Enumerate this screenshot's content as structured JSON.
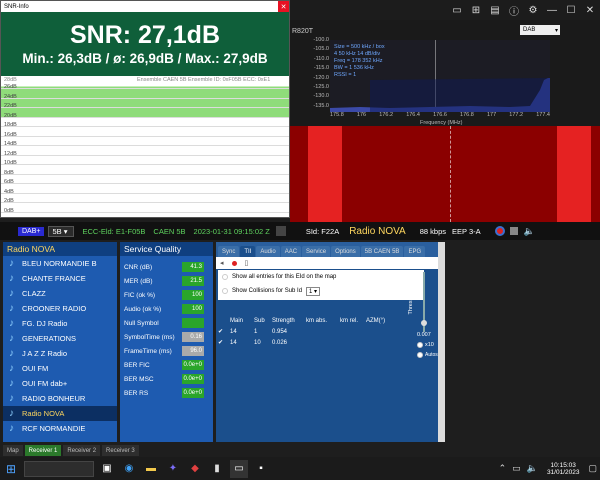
{
  "snr": {
    "window_title": "SNR-Info",
    "main": "SNR: 27,1dB",
    "stats": "Min.: 26,3dB / ø: 26,9dB / Max.: 27,9dB",
    "chart_header": "Ensemble CAEN 5B  Ensemble ID: 0xF05B  ECC: 0xE1",
    "y_top": "28dB",
    "y_labels": [
      "26dB",
      "24dB",
      "22dB",
      "20dB",
      "18dB",
      "16dB",
      "14dB",
      "12dB",
      "10dB",
      "8dB",
      "6dB",
      "4dB",
      "2dB",
      "0dB"
    ],
    "fill_color": "#8fdc7a"
  },
  "spectrum": {
    "device": "R820T",
    "mode": "DAB",
    "info_lines": [
      "Size = 500 kHz / box",
      "4 50 kHz 14 dB/div",
      "Freq = 178 352 kHz",
      "BW = 1 536 kHz",
      "RSSI = 1"
    ],
    "y_ticks": [
      "-100.0",
      "-105.0",
      "-110.0",
      "-115.0",
      "-120.0",
      "-125.0",
      "-130.0",
      "-135.0"
    ],
    "x_ticks": [
      "175.8",
      "176",
      "176.2",
      "176.4",
      "176.6",
      "176.8",
      "177",
      "177.2",
      "177.4"
    ],
    "x_label": "Frequency (MHz)"
  },
  "status": {
    "mode": "DAB+",
    "channel": "5B",
    "ecc": "ECC-Eld: E1-F05B",
    "ensemble": "CAEN 5B",
    "datetime": "2023-01-31  09:15:02 Z",
    "sid": "SId: F22A",
    "station": "Radio NOVA",
    "bitrate": "88 kbps",
    "eep": "EEP 3-A"
  },
  "stations": {
    "header": "Radio NOVA",
    "items": [
      "BLEU NORMANDIE B",
      "CHANTE FRANCE",
      "CLAZZ",
      "CROONER RADIO",
      "FG. DJ Radio",
      "GENERATIONS",
      "J A Z Z Radio",
      "OUI FM",
      "OUI FM dab+",
      "RADIO BONHEUR",
      "Radio NOVA",
      "RCF NORMANDIE"
    ],
    "selected_index": 10
  },
  "quality": {
    "title": "Service Quality",
    "rows": [
      {
        "label": "CNR (dB)",
        "value": "41.3",
        "color": "#2aa52a"
      },
      {
        "label": "MER (dB)",
        "value": "21.5",
        "color": "#2aa52a"
      },
      {
        "label": "FIC (ok %)",
        "value": "100",
        "color": "#2aa52a"
      },
      {
        "label": "Audio (ok %)",
        "value": "100",
        "color": "#2aa52a"
      },
      {
        "label": "Null Symbol",
        "value": "",
        "color": "#2aa52a"
      },
      {
        "label": "SymbolTime (ms)",
        "value": "0.16",
        "color": "#aaaaaa"
      },
      {
        "label": "FrameTime (ms)",
        "value": "96.0",
        "color": "#aaaaaa"
      },
      {
        "label": "BER FIC",
        "value": "0.0e+0",
        "color": "#2aa52a"
      },
      {
        "label": "BER MSC",
        "value": "0.0e+0",
        "color": "#2aa52a"
      },
      {
        "label": "BER RS",
        "value": "0.0e+0",
        "color": "#2aa52a"
      }
    ]
  },
  "tabs": {
    "items": [
      "Sync",
      "TII",
      "Audio",
      "AAC",
      "Service",
      "Options",
      "5B CAEN 5B",
      "EPG"
    ],
    "active_index": 1,
    "show_all_label": "Show all entries for this EId on the map",
    "show_collisions_label": "Show Collisions for Sub Id",
    "collision_value": "1",
    "threshold_label": "Threshold",
    "threshold_value": "0.007",
    "x10_label": "x10",
    "auto_label": "Autoscal",
    "columns": [
      "Main",
      "Sub",
      "Strength",
      "km abs.",
      "km rel.",
      "AZM(°)"
    ],
    "rows": [
      [
        "14",
        "1",
        "0.954",
        "",
        "",
        ""
      ],
      [
        "14",
        "10",
        "0.026",
        "",
        "",
        ""
      ]
    ]
  },
  "bottom_tabs": {
    "items": [
      "Map",
      "Receiver 1",
      "Receiver 2",
      "Receiver 3"
    ],
    "active_index": 1
  },
  "taskbar": {
    "time": "10:15:03",
    "date": "31/01/2023"
  }
}
